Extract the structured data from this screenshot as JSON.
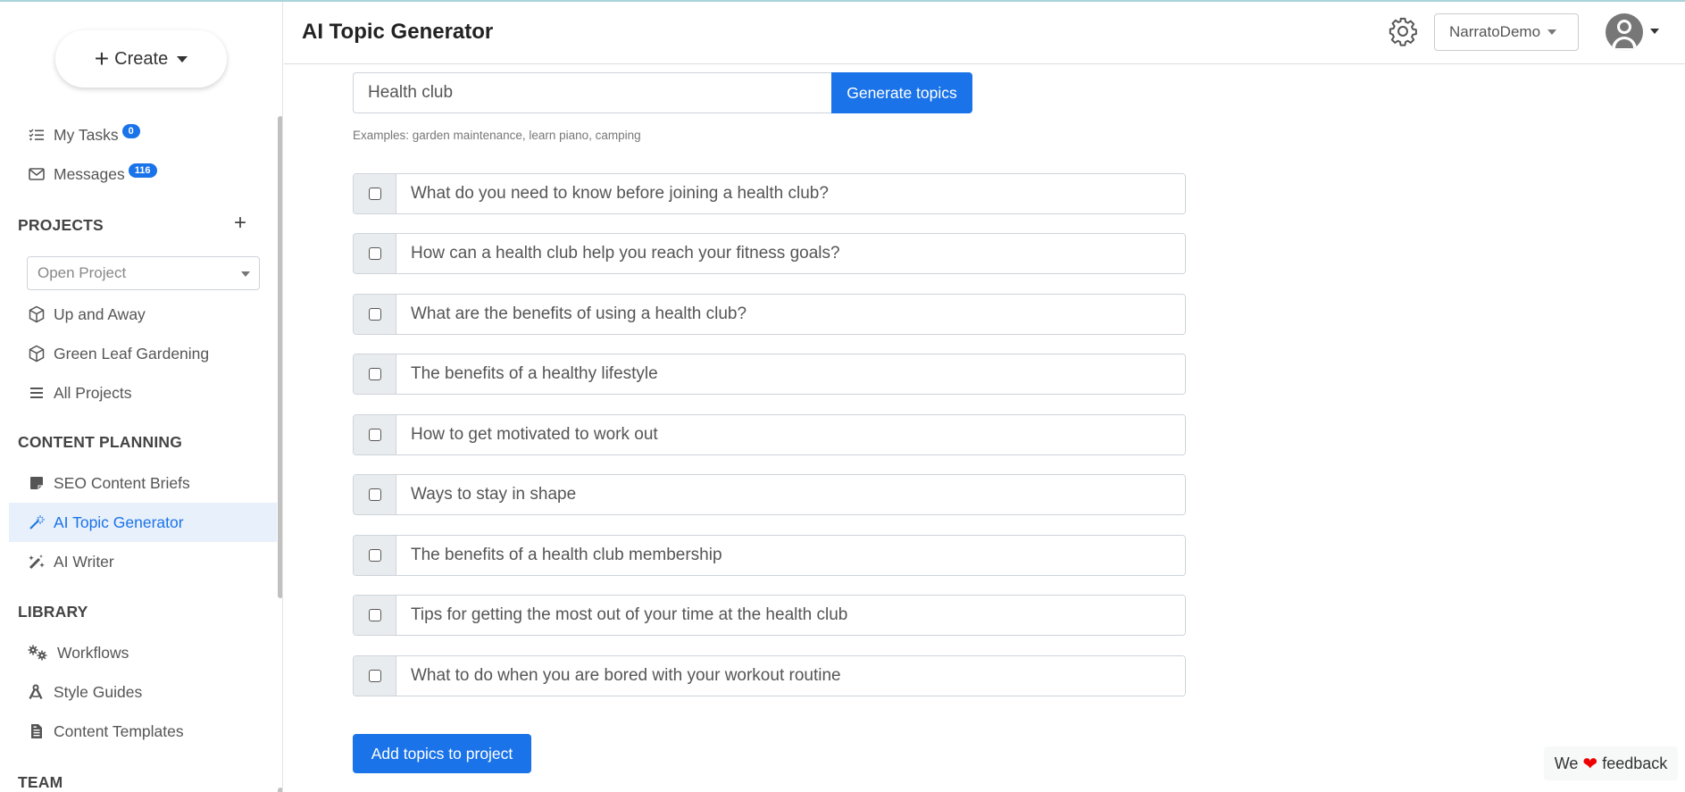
{
  "header": {
    "title": "AI Topic Generator",
    "workspace": "NarratoDemo"
  },
  "sidebar": {
    "create_label": "Create",
    "my_tasks": {
      "label": "My Tasks",
      "count": "0"
    },
    "messages": {
      "label": "Messages",
      "count": "116"
    },
    "projects_heading": "PROJECTS",
    "open_project_placeholder": "Open Project",
    "projects": [
      {
        "label": "Up and Away"
      },
      {
        "label": "Green Leaf Gardening"
      },
      {
        "label": "All Projects"
      }
    ],
    "content_planning_heading": "CONTENT PLANNING",
    "content_planning": [
      {
        "label": "SEO Content Briefs"
      },
      {
        "label": "AI Topic Generator"
      },
      {
        "label": "AI Writer"
      }
    ],
    "library_heading": "LIBRARY",
    "library": [
      {
        "label": "Workflows"
      },
      {
        "label": "Style Guides"
      },
      {
        "label": "Content Templates"
      }
    ],
    "team_heading": "TEAM"
  },
  "main": {
    "topic_input_value": "Health club",
    "generate_label": "Generate topics",
    "examples_text": "Examples: garden maintenance, learn piano, camping",
    "topics": [
      {
        "text": "What do you need to know before joining a health club?",
        "checked": false
      },
      {
        "text": "How can a health club help you reach your fitness goals?",
        "checked": false
      },
      {
        "text": "What are the benefits of using a health club?",
        "checked": false
      },
      {
        "text": "The benefits of a healthy lifestyle",
        "checked": false
      },
      {
        "text": "How to get motivated to work out",
        "checked": false
      },
      {
        "text": "Ways to stay in shape",
        "checked": false
      },
      {
        "text": "The benefits of a health club membership",
        "checked": false
      },
      {
        "text": "Tips for getting the most out of your time at the health club",
        "checked": false
      },
      {
        "text": "What to do when you are bored with your workout routine",
        "checked": false
      }
    ],
    "add_label": "Add topics to project"
  },
  "feedback": {
    "prefix": "We",
    "suffix": "feedback"
  },
  "colors": {
    "accent": "#1a73e8",
    "active_bg": "#e8f0fb",
    "heart": "#ee0000"
  }
}
